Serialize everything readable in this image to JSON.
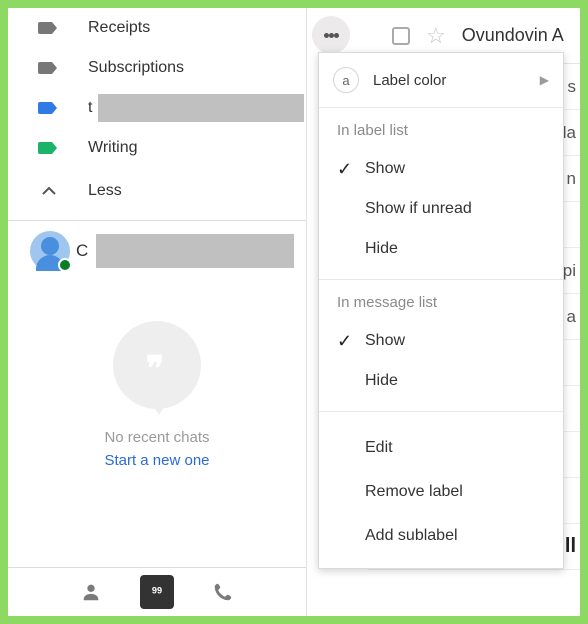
{
  "sidebar": {
    "labels": [
      {
        "name": "Receipts",
        "color": "#777777"
      },
      {
        "name": "Subscriptions",
        "color": "#777777"
      },
      {
        "name": "t",
        "color": "#2f7ae5",
        "redacted": true
      },
      {
        "name": "Writing",
        "color": "#1bb36a"
      }
    ],
    "less_label": "Less"
  },
  "chat": {
    "initial": "C",
    "empty_text": "No recent chats",
    "start_text": "Start a new one"
  },
  "mail_peek": {
    "sender": "Ovundovin A",
    "row_letters": [
      "s",
      "la",
      "n",
      "",
      "pi",
      "a",
      "",
      "",
      "",
      "",
      "ill"
    ]
  },
  "menu": {
    "label_color": "Label color",
    "label_letter": "a",
    "in_label_list": "In label list",
    "show": "Show",
    "show_if_unread": "Show if unread",
    "hide": "Hide",
    "in_message_list": "In message list",
    "edit": "Edit",
    "remove": "Remove label",
    "add_sublabel": "Add sublabel"
  }
}
